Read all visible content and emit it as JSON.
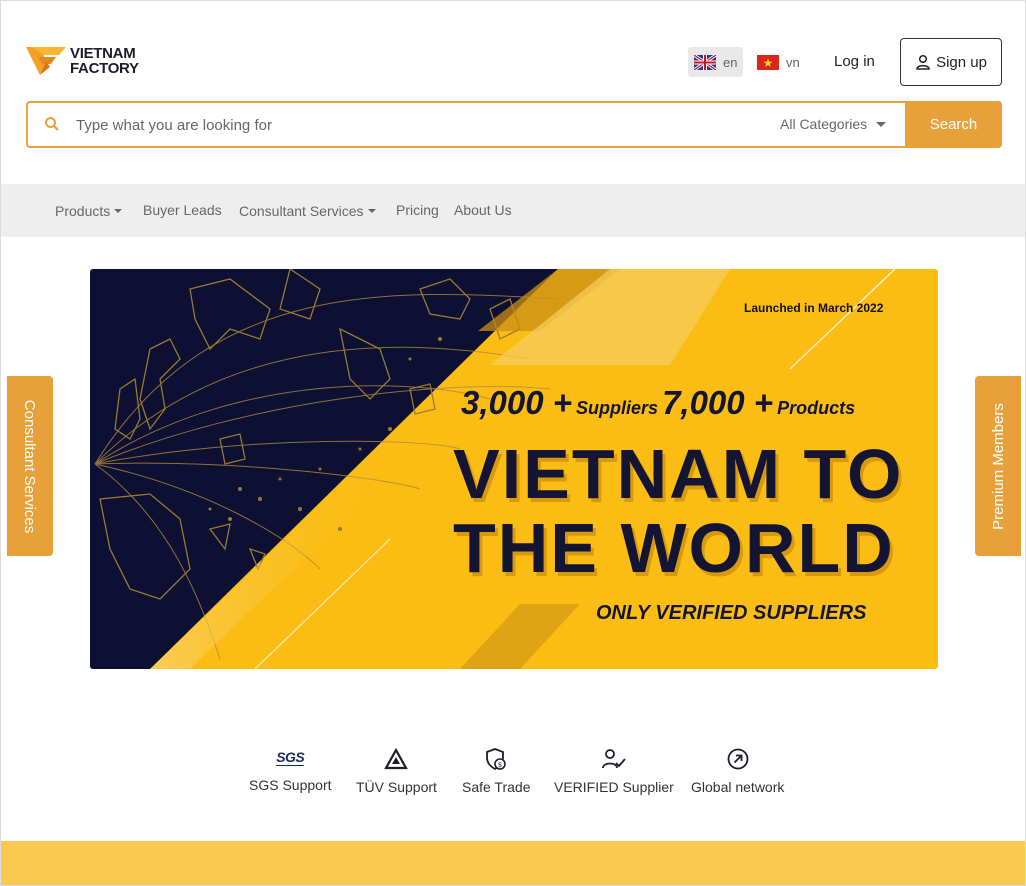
{
  "brand": {
    "name_line1": "VIETNAM",
    "name_line2": "FACTORY",
    "accent": "#e8a13a",
    "dark": "#141433"
  },
  "header": {
    "languages": [
      {
        "code": "en",
        "flag": "uk-flag-icon",
        "active": true
      },
      {
        "code": "vn",
        "flag": "vietnam-flag-icon",
        "active": false
      }
    ],
    "login_label": "Log in",
    "signup_label": "Sign up"
  },
  "search": {
    "placeholder": "Type what you are looking for",
    "value": "",
    "category": "All Categories",
    "button_label": "Search"
  },
  "nav": {
    "items": [
      {
        "label": "Products",
        "dropdown": true
      },
      {
        "label": "Buyer Leads",
        "dropdown": false
      },
      {
        "label": "Consultant Services",
        "dropdown": true
      },
      {
        "label": "Pricing",
        "dropdown": false
      },
      {
        "label": "About Us",
        "dropdown": false
      }
    ]
  },
  "side_tabs": {
    "left": "Consultant Services",
    "right": "Premium Members"
  },
  "banner": {
    "launched": "Launched in March 2022",
    "suppliers_count": "3,000 +",
    "suppliers_label": "Suppliers",
    "products_count": "7,000 +",
    "products_label": "Products",
    "title_line1": "VIETNAM TO",
    "title_line2": "THE WORLD",
    "tagline": "ONLY VERIFIED SUPPLIERS",
    "colors": {
      "navy": "#0d0f33",
      "yellow": "#fbbd14",
      "light_yellow": "#f7cf5e"
    }
  },
  "features": [
    {
      "label": "SGS Support",
      "icon": "sgs-logo-icon",
      "logo_text": "SGS"
    },
    {
      "label": "TÜV Support",
      "icon": "tuv-triangle-icon"
    },
    {
      "label": "Safe Trade",
      "icon": "shield-dollar-icon"
    },
    {
      "label": "VERIFIED Supplier",
      "icon": "user-check-icon"
    },
    {
      "label": "Global network",
      "icon": "arrow-circle-icon"
    }
  ]
}
